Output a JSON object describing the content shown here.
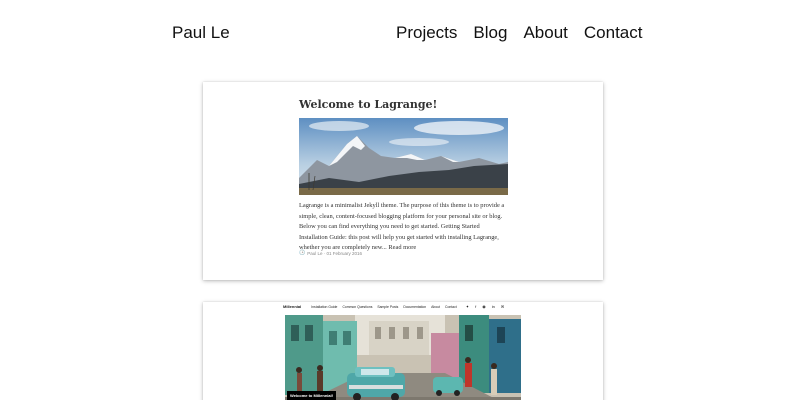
{
  "header": {
    "brand": "Paul Le",
    "nav": [
      "Projects",
      "Blog",
      "About",
      "Contact"
    ]
  },
  "posts": [
    {
      "title": "Welcome to Lagrange!",
      "excerpt": "Lagrange is a minimalist Jekyll theme. The purpose of this theme is to provide a simple, clean, content-focused blogging platform for your personal site or blog. Below you can find everything you need to get started. Getting Started Installation Guide: this post will help you get started with installing Lagrange, whether you are completely new...",
      "read_more": "Read more",
      "meta": "Paul Le · 01 February 2016"
    },
    {
      "site_preview": {
        "brand": "Millennial",
        "nav": [
          "Installation Guide",
          "Common Questions",
          "Sample Posts",
          "Documentation",
          "About",
          "Contact"
        ],
        "caption": "Welcome to Millennial!"
      }
    }
  ],
  "icons": {
    "meta": "clock-icon",
    "social": [
      "twitter-icon",
      "facebook-icon",
      "github-icon",
      "linkedin-icon",
      "email-icon"
    ]
  }
}
